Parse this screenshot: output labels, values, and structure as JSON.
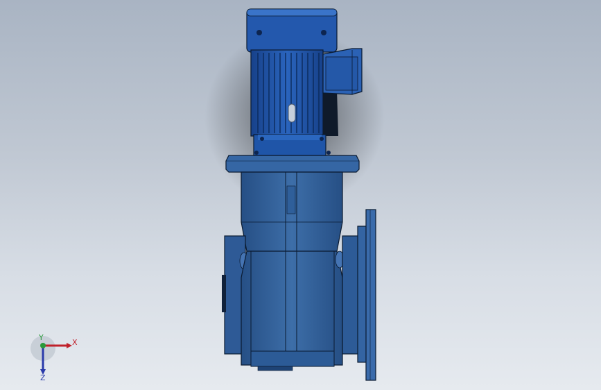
{
  "viewport": {
    "background_top": "#a9b4c3",
    "background_bottom": "#e6eaef"
  },
  "model": {
    "part_color": "#2f5f9a",
    "part_dark": "#1d3f6c",
    "part_light": "#4a7dbd",
    "motor_color": "#1f55a8",
    "edge_color": "#0a1a30"
  },
  "triad": {
    "x_label": "X",
    "y_label": "Y",
    "z_label": "Z",
    "x_color": "#c0202a",
    "y_color": "#2a9a3a",
    "z_color": "#2a3aaa"
  }
}
